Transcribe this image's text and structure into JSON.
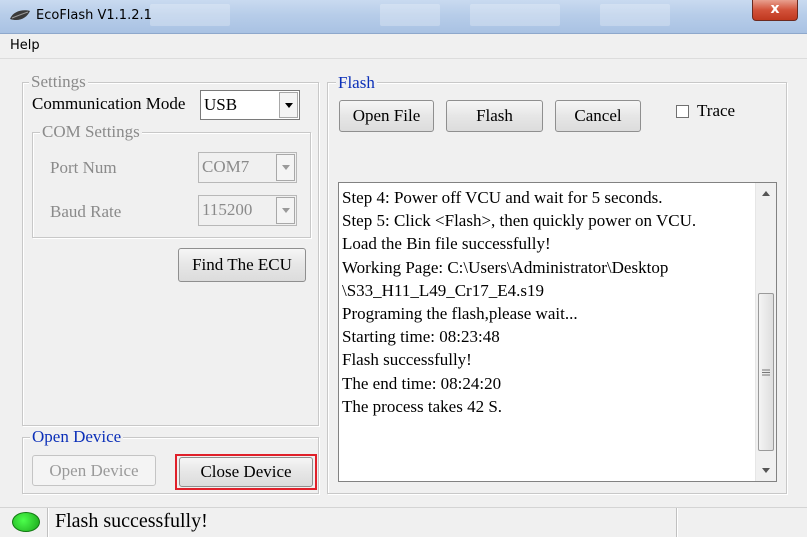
{
  "window": {
    "title": "EcoFlash V1.1.2.1",
    "close_glyph": "x"
  },
  "menu": {
    "items": [
      "Help"
    ]
  },
  "settings": {
    "group_label": "Settings",
    "comm_mode_label": "Communication Mode",
    "comm_mode_value": "USB",
    "com_group_label": "COM Settings",
    "port_label": "Port Num",
    "port_value": "COM7",
    "baud_label": "Baud Rate",
    "baud_value": "115200",
    "find_ecu_label": "Find The ECU"
  },
  "open_device": {
    "group_label": "Open Device",
    "open_label": "Open Device",
    "close_label": "Close Device",
    "highlight_color": "#e0202a"
  },
  "flash": {
    "group_label": "Flash",
    "open_file_label": "Open File",
    "flash_label": "Flash",
    "cancel_label": "Cancel",
    "trace_label": "Trace",
    "trace_checked": false,
    "log_lines": [
      "Step 4: Power off VCU and wait for 5 seconds.",
      "Step 5: Click <Flash>, then quickly power on VCU.",
      "Load the Bin file successfully!",
      "Working Page: C:\\Users\\Administrator\\Desktop",
      "\\S33_H11_L49_Cr17_E4.s19",
      "Programing the flash,please wait...",
      "Starting time: 08:23:48",
      "Flash successfully!",
      "The end time: 08:24:20",
      "The process takes 42 S."
    ]
  },
  "status": {
    "text": "Flash successfully!",
    "led_color": "#22c822"
  },
  "icons": {
    "app": "eco-leaf-icon",
    "scroll_grip": "grip-icon"
  }
}
